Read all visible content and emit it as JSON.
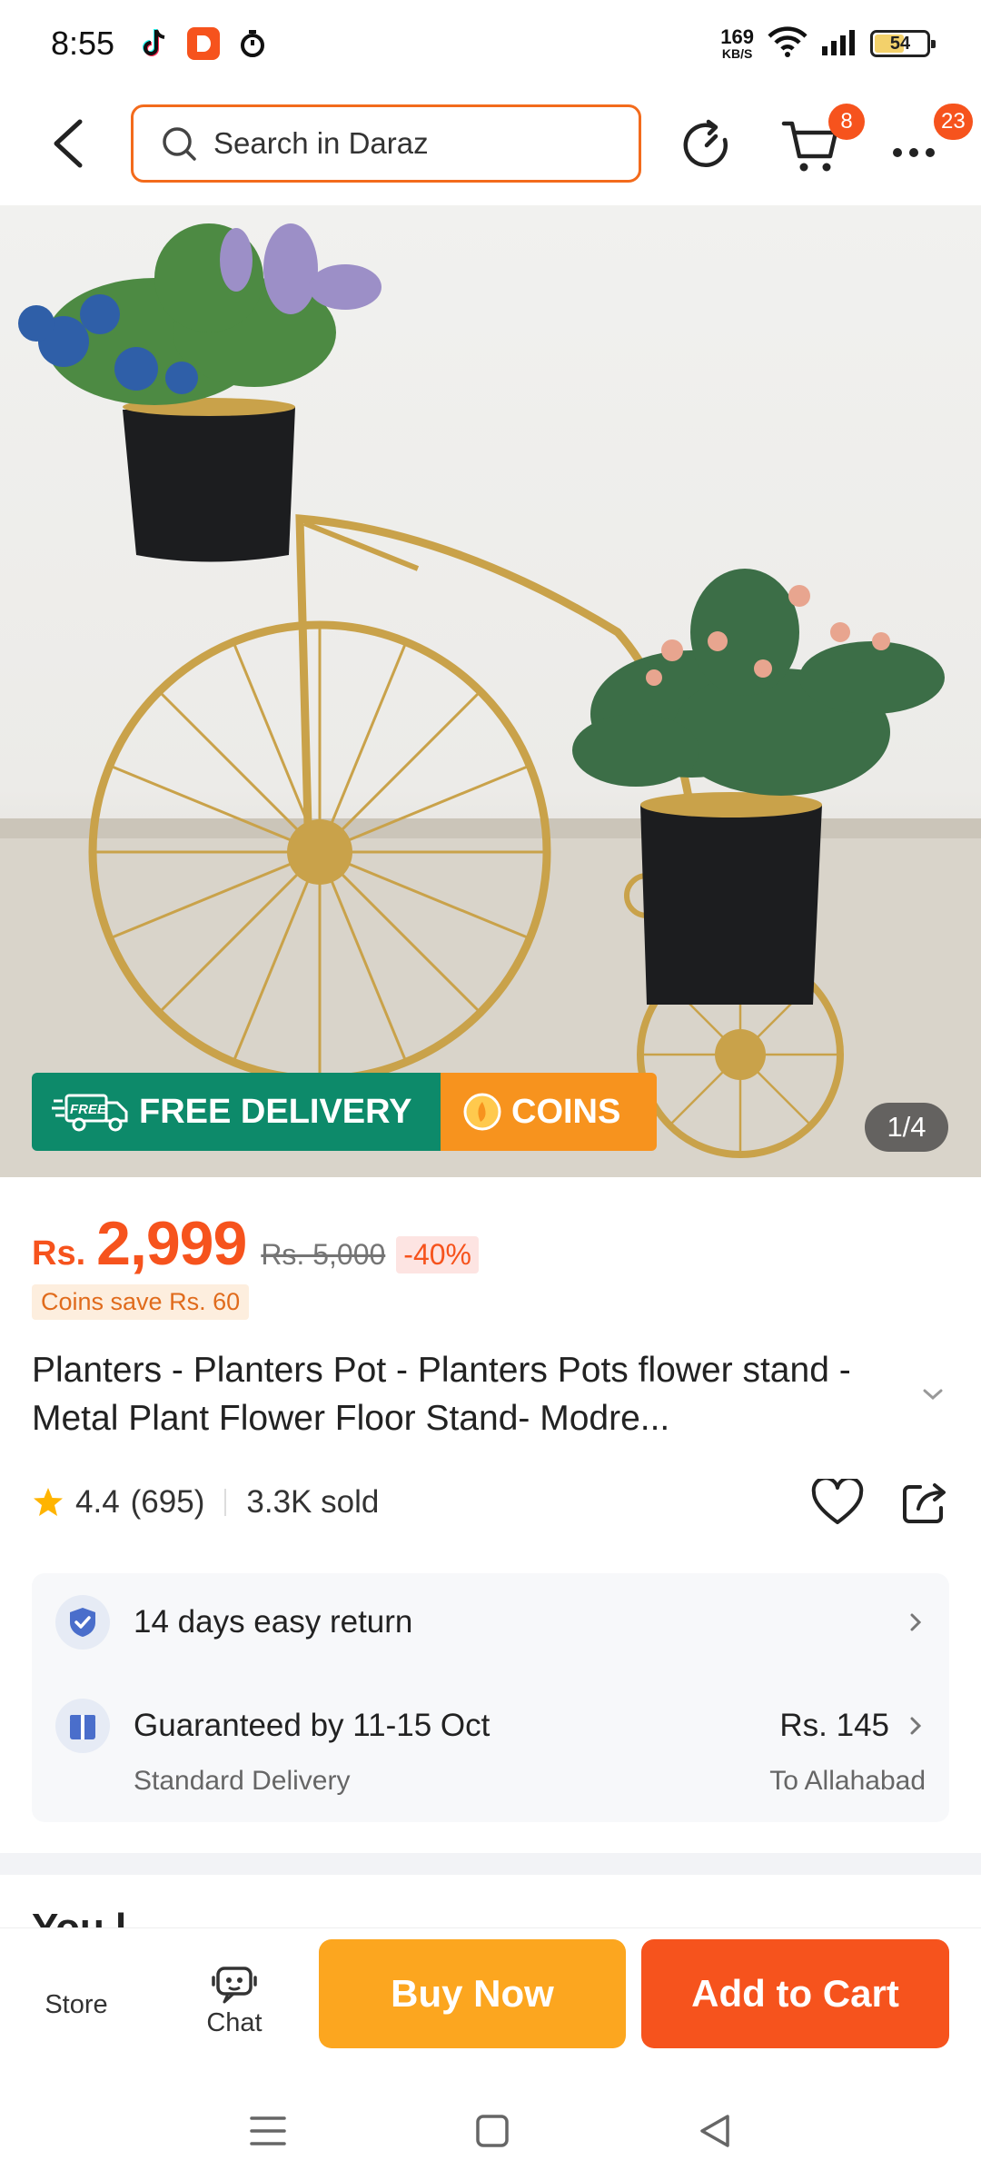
{
  "status_bar": {
    "time": "8:55",
    "network_speed_value": "169",
    "network_speed_unit": "KB/S",
    "battery_level": "54"
  },
  "top_nav": {
    "search_placeholder": "Search in Daraz",
    "cart_count": "8",
    "more_count": "23"
  },
  "gallery": {
    "promo_free_label": "FREE",
    "promo_free_delivery": "FREE DELIVERY",
    "promo_coins": "COINS",
    "page_counter": "1/4"
  },
  "product": {
    "currency": "Rs.",
    "price": "2,999",
    "original_price": "Rs. 5,000",
    "discount": "-40%",
    "coins_save": "Coins save Rs. 60",
    "title": "Planters - Planters Pot - Planters Pots flower stand - Metal Plant Flower Floor Stand- Modre...",
    "rating": "4.4",
    "review_count": "(695)",
    "sold": "3.3K sold"
  },
  "service": {
    "return_label": "14 days easy return",
    "delivery_label": "Guaranteed by 11-15 Oct",
    "delivery_type": "Standard Delivery",
    "delivery_fee": "Rs. 145",
    "delivery_location": "To Allahabad"
  },
  "section_peek": "You l",
  "bottom_bar": {
    "store_label": "Store",
    "chat_label": "Chat",
    "buy_now_label": "Buy Now",
    "add_to_cart_label": "Add to Cart"
  },
  "colors": {
    "accent": "#f6531d",
    "buy_now": "#fca61f",
    "free_delivery": "#0d8a6a",
    "coins": "#f7931e"
  }
}
